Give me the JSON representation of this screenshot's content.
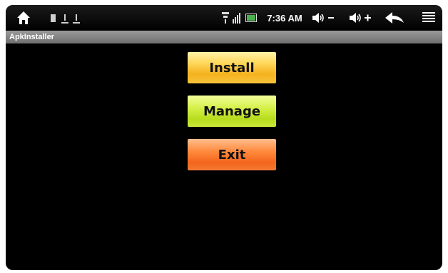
{
  "statusbar": {
    "time": "7:36 AM",
    "icons": [
      "home-icon",
      "notification-usb-icon",
      "notification-download-icon",
      "wifi-icon",
      "signal-icon",
      "battery-icon",
      "volume-down-icon",
      "volume-up-icon",
      "back-icon",
      "menu-icon"
    ]
  },
  "app": {
    "title": "ApkInstaller"
  },
  "buttons": {
    "install": "Install",
    "manage": "Manage",
    "exit": "Exit"
  },
  "colors": {
    "install": "#f7c33a",
    "manage": "#c9e83a",
    "exit": "#f57a36",
    "background": "#000000"
  }
}
